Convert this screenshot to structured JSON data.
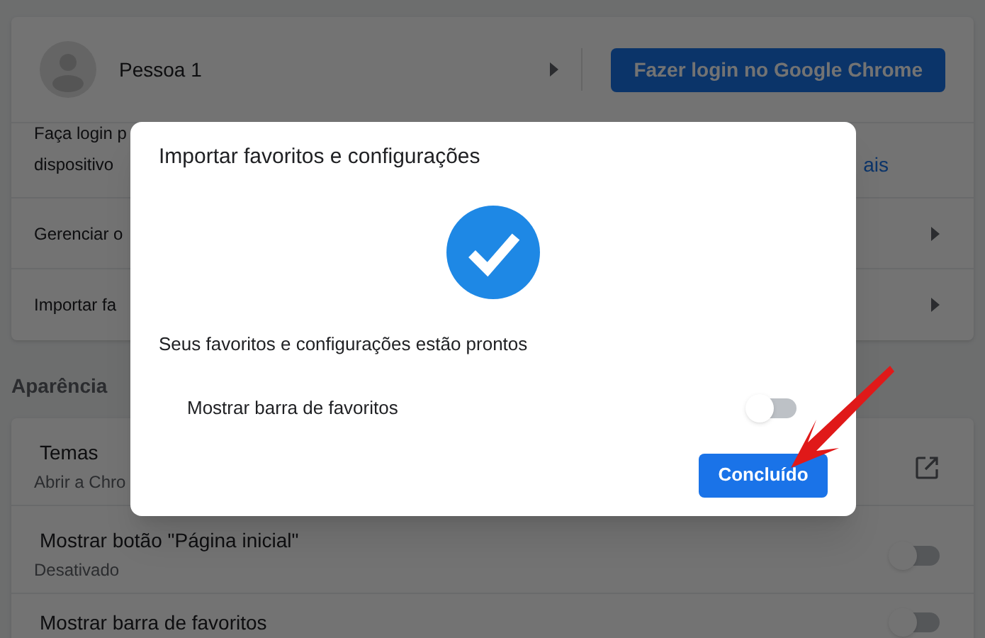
{
  "profile": {
    "name": "Pessoa 1",
    "sign_in_button": "Fazer login no Google Chrome"
  },
  "sign_in_prompt": {
    "line_1": "Faça login p",
    "line_2": "dispositivo",
    "link": "ais"
  },
  "menu_rows": [
    "Gerenciar o",
    "Importar fa"
  ],
  "appearance": {
    "heading": "Aparência",
    "rows": [
      {
        "kind": "external",
        "title": "Temas",
        "subtitle": "Abrir a Chro"
      },
      {
        "kind": "toggle",
        "title": "Mostrar botão \"Página inicial\"",
        "subtitle": "Desativado",
        "on": false
      },
      {
        "kind": "toggle",
        "title": "Mostrar barra de favoritos",
        "on": false
      }
    ]
  },
  "dialog": {
    "title": "Importar favoritos e configurações",
    "message": "Seus favoritos e configurações estão prontos",
    "toggle": {
      "label": "Mostrar barra de favoritos",
      "on": false
    },
    "done_button": "Concluído"
  }
}
